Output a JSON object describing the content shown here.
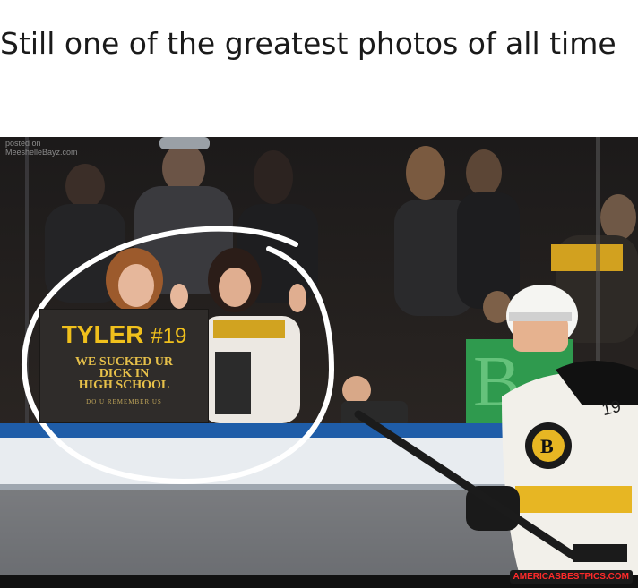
{
  "caption": "Still one of the greatest photos of all time",
  "photo": {
    "watermark": "posted on\nMeeshelleBayz.com",
    "sign": {
      "name": "TYLER",
      "number": "#19",
      "line1": "WE SUCKED UR",
      "line2": "DICK IN",
      "line3": "HIGH SCHOOL",
      "small": "DO U REMEMBER US"
    },
    "jersey_number": "19",
    "circle_color": "#ffffff"
  },
  "site_credit": "AMERICASBESTPICS.COM"
}
